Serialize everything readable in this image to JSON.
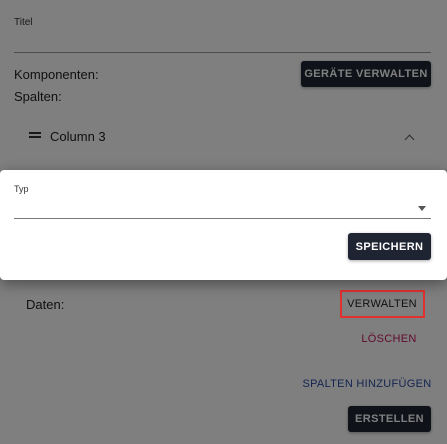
{
  "form": {
    "title_label": "Titel",
    "components_label": "Komponenten:",
    "manage_devices_button": "GERÄTE VERWALTEN",
    "columns_label": "Spalten:",
    "column_item_label": "Column 3",
    "data_label": "Daten:",
    "manage_button": "VERWALTEN",
    "delete_button": "LÖSCHEN",
    "add_columns_button": "SPALTEN HINZUFÜGEN",
    "create_button": "ERSTELLEN"
  },
  "dialog": {
    "type_label": "Typ",
    "type_value": "",
    "save_button": "SPEICHERN"
  },
  "colors": {
    "primary_dark": "#1f2433",
    "delete_text": "#c2185b",
    "link_text": "#2a4aa0",
    "highlight": "#e03030"
  }
}
